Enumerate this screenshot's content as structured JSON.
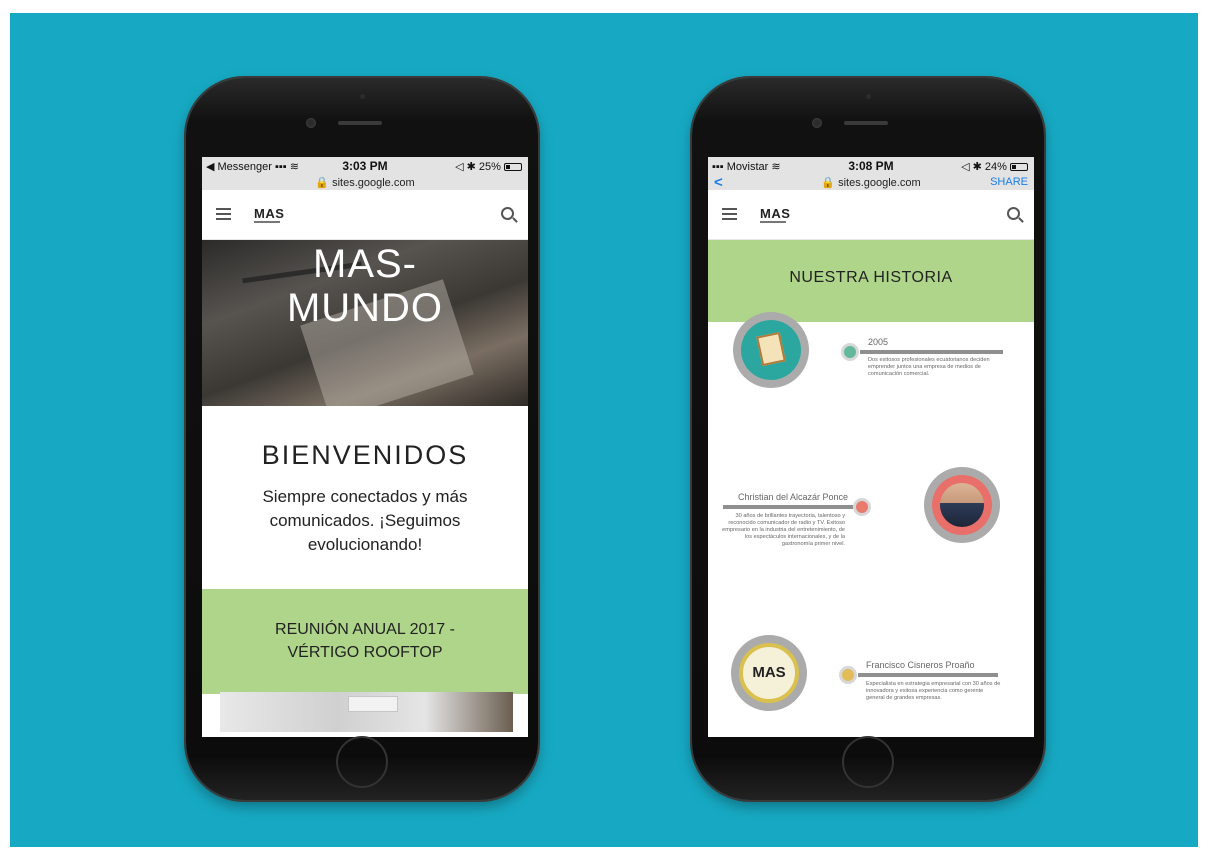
{
  "left_phone": {
    "status": {
      "carrier": "◀ Messenger ▪▪▪ ≋",
      "time": "3:03 PM",
      "right": "◁ ✱ 25%",
      "battery_level": 0.25
    },
    "url": "🔒 sites.google.com",
    "nav": {
      "logo": "MAS"
    },
    "hero": {
      "title_line1": "MAS-",
      "title_line2": "MUNDO"
    },
    "welcome": {
      "heading": "BIENVENIDOS",
      "text": "Siempre conectados y más comunicados. ¡Seguimos evolucionando!"
    },
    "band": {
      "line1": "REUNIÓN ANUAL 2017 -",
      "line2": "VÉRTIGO ROOFTOP"
    }
  },
  "right_phone": {
    "status": {
      "carrier": "▪▪▪ Movistar ≋",
      "time": "3:08 PM",
      "right": "◁ ✱ 24%",
      "battery_level": 0.24
    },
    "url": "🔒 sites.google.com",
    "url_back": "<",
    "url_share": "SHARE",
    "nav": {
      "logo": "MAS"
    },
    "history_title": "NUESTRA HISTORIA",
    "timeline": [
      {
        "title": "2005",
        "desc": "Dos exitosos profesionales ecuatorianos deciden emprender juntos una empresa de medios de comunicación comercial.",
        "dot_color": "#63b89a"
      },
      {
        "title": "Christian del Alcazár Ponce",
        "desc": "30 años de brillantes trayectoria, talentoso y reconocido comunicador de radio y TV. Exitoso empresario en la industria del entretenimiento, de los espectáculos internacionales, y de la gastronomía primer nivel.",
        "dot_color": "#ea7a6e"
      },
      {
        "title": "Francisco Cisneros Proaño",
        "desc": "Especialista en estrategia empresarial con 30 años de innovadora y exitosa experiencia como gerente general de grandes empresas.",
        "dot_color": "#e3bc5a",
        "logo": "MAS"
      }
    ]
  },
  "colors": {
    "background": "#17a9c3",
    "band": "#aed589"
  }
}
